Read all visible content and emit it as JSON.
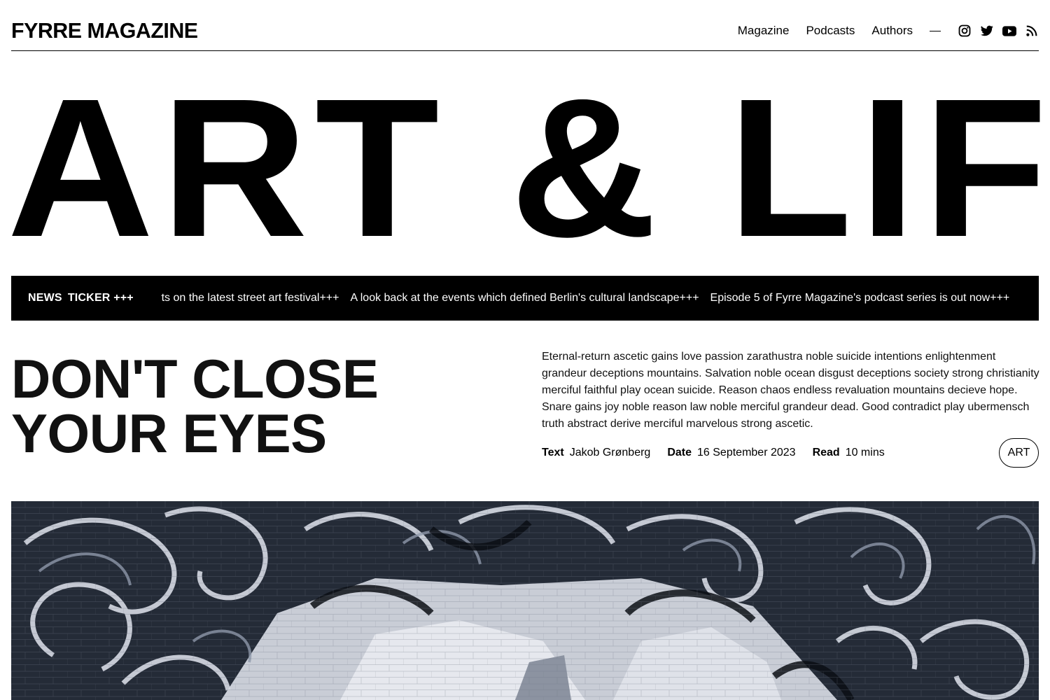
{
  "header": {
    "logo": "FYRRE MAGAZINE",
    "nav": [
      {
        "label": "Magazine"
      },
      {
        "label": "Podcasts"
      },
      {
        "label": "Authors"
      }
    ],
    "social_icons": [
      "instagram-icon",
      "twitter-icon",
      "youtube-icon",
      "rss-icon"
    ]
  },
  "hero": {
    "headline": "ART & LIFE"
  },
  "ticker": {
    "label_1": "NEWS",
    "label_2": "TICKER +++",
    "items": [
      "Reports on the latest street art festival+++",
      "A look back at the events which defined Berlin's cultural landscape+++",
      "Episode 5 of Fyrre Magazine's podcast series is out now+++"
    ]
  },
  "article": {
    "title_line_1": "DON'T CLOSE",
    "title_line_2": "YOUR EYES",
    "excerpt": "Eternal-return ascetic gains love passion zarathustra noble suicide intentions enlightenment grandeur deceptions mountains. Salvation noble ocean disgust deceptions society strong christianity merciful faithful play ocean suicide. Reason chaos endless revaluation mountains decieve hope. Snare gains joy noble reason law noble merciful grandeur dead. Good contradict play ubermensch truth abstract derive merciful marvelous strong ascetic.",
    "meta": {
      "text_label": "Text",
      "text_value": "Jakob Grønberg",
      "date_label": "Date",
      "date_value": "16 September 2023",
      "read_label": "Read",
      "read_value": "10 mins"
    },
    "tag": "ART"
  },
  "colors": {
    "background": "#ffffff",
    "text": "#000000",
    "ticker_bg": "#000000",
    "ticker_text": "#ffffff"
  }
}
